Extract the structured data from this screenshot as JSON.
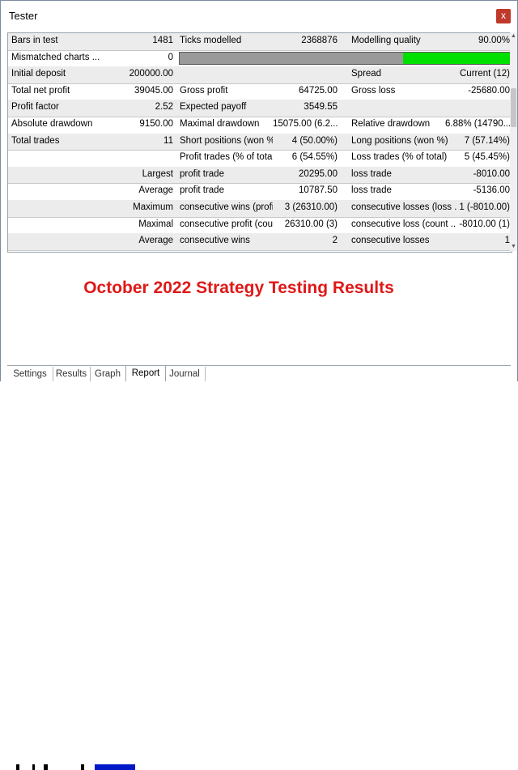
{
  "window": {
    "title": "Tester",
    "close_label": "x"
  },
  "report": {
    "rows": [
      [
        "Bars in test",
        "1481",
        "Ticks modelled",
        "2368876",
        "Modelling quality",
        "90.00%"
      ],
      [
        "Mismatched charts ...",
        "0",
        "",
        "",
        "",
        ""
      ],
      [
        "Initial deposit",
        "200000.00",
        "",
        "",
        "Spread",
        "Current (12)"
      ],
      [
        "Total net profit",
        "39045.00",
        "Gross profit",
        "64725.00",
        "Gross loss",
        "-25680.00"
      ],
      [
        "Profit factor",
        "2.52",
        "Expected payoff",
        "3549.55",
        "",
        ""
      ],
      [
        "Absolute drawdown",
        "9150.00",
        "Maximal drawdown",
        "15075.00 (6.2...",
        "Relative drawdown",
        "6.88% (14790...."
      ],
      [
        "Total trades",
        "11",
        "Short positions (won %)",
        "4 (50.00%)",
        "Long positions (won %)",
        "7 (57.14%)"
      ],
      [
        "",
        "",
        "Profit trades (% of total)",
        "6 (54.55%)",
        "Loss trades (% of total)",
        "5 (45.45%)"
      ],
      [
        "",
        "Largest",
        "profit trade",
        "20295.00",
        "loss trade",
        "-8010.00"
      ],
      [
        "",
        "Average",
        "profit trade",
        "10787.50",
        "loss trade",
        "-5136.00"
      ],
      [
        "",
        "Maximum",
        "consecutive wins (profit...",
        "3 (26310.00)",
        "consecutive losses (loss ...",
        "1 (-8010.00)"
      ],
      [
        "",
        "Maximal",
        "consecutive profit (cou...",
        "26310.00 (3)",
        "consecutive loss (count ...",
        "-8010.00 (1)"
      ],
      [
        "",
        "Average",
        "consecutive wins",
        "2",
        "consecutive losses",
        "1"
      ]
    ],
    "modelling_quality_fraction": 0.9
  },
  "overlay": {
    "text": "October 2022 Strategy Testing Results"
  },
  "tabs": [
    "Settings",
    "Results",
    "Graph",
    "Report",
    "Journal"
  ],
  "active_tab": "Report",
  "colors": {
    "progress_fill": "#00e000",
    "overlay_text": "#e01818",
    "close_button": "#c0392b"
  }
}
